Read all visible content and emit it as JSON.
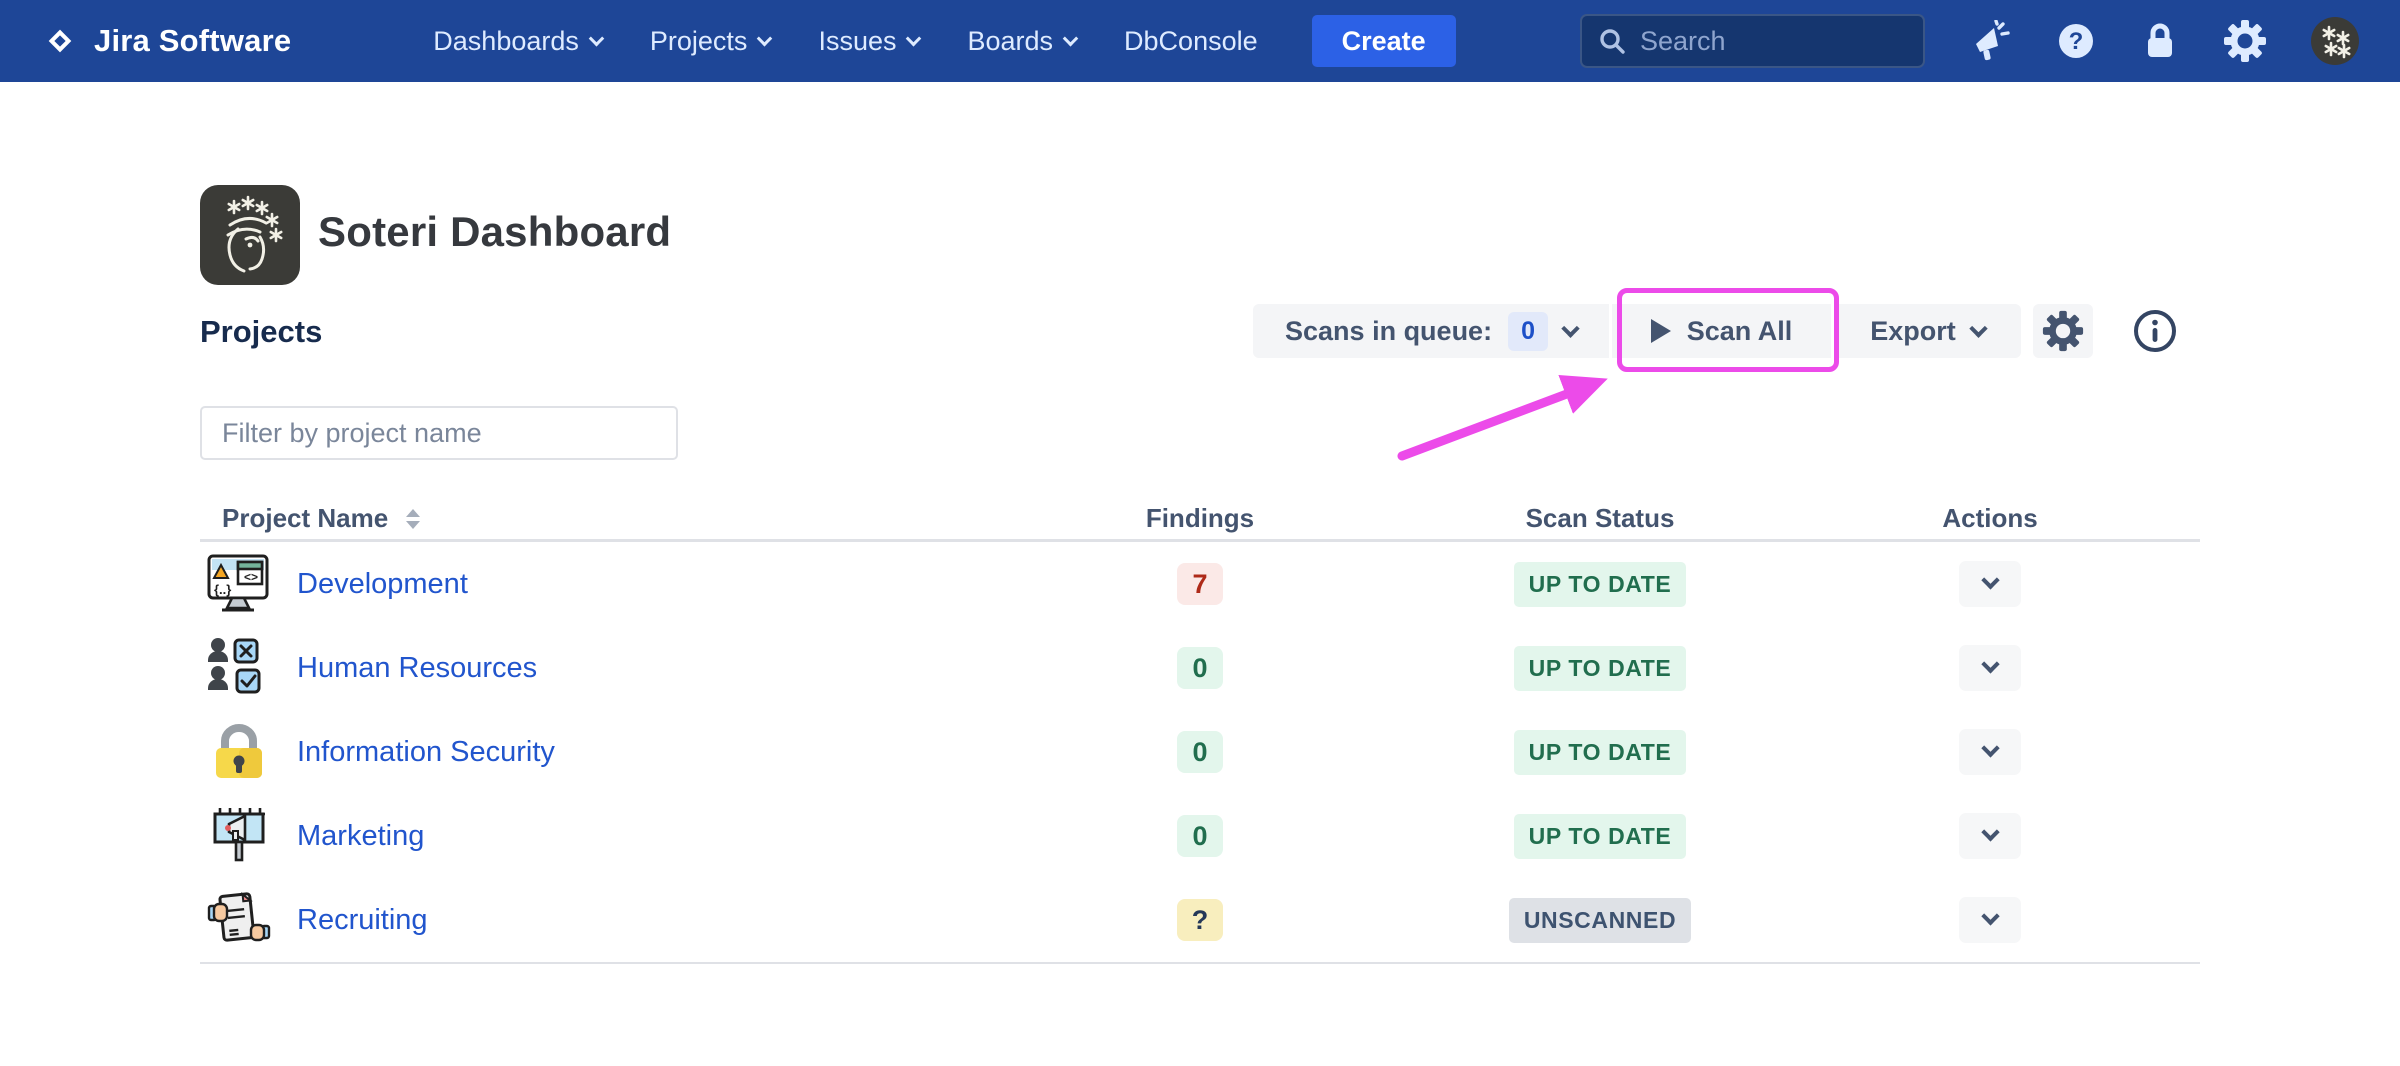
{
  "nav": {
    "brand": "Jira Software",
    "items": [
      {
        "label": "Dashboards",
        "has_chevron": true
      },
      {
        "label": "Projects",
        "has_chevron": true
      },
      {
        "label": "Issues",
        "has_chevron": true
      },
      {
        "label": "Boards",
        "has_chevron": true
      },
      {
        "label": "DbConsole",
        "has_chevron": false
      }
    ],
    "create_label": "Create",
    "search_placeholder": "Search"
  },
  "header": {
    "title": "Soteri Dashboard"
  },
  "section": {
    "heading": "Projects"
  },
  "controls": {
    "scans_in_queue_label": "Scans in queue:",
    "scans_in_queue_count": "0",
    "scan_all_label": "Scan All",
    "export_label": "Export"
  },
  "filter": {
    "placeholder": "Filter by project name"
  },
  "table": {
    "columns": [
      "Project Name",
      "Findings",
      "Scan Status",
      "Actions"
    ],
    "rows": [
      {
        "name": "Development",
        "icon": "development",
        "findings": "7",
        "findings_type": "danger",
        "status": "UP TO DATE",
        "status_type": "success"
      },
      {
        "name": "Human Resources",
        "icon": "human-resources",
        "findings": "0",
        "findings_type": "success",
        "status": "UP TO DATE",
        "status_type": "success"
      },
      {
        "name": "Information Security",
        "icon": "information-security",
        "findings": "0",
        "findings_type": "success",
        "status": "UP TO DATE",
        "status_type": "success"
      },
      {
        "name": "Marketing",
        "icon": "marketing",
        "findings": "0",
        "findings_type": "success",
        "status": "UP TO DATE",
        "status_type": "success"
      },
      {
        "name": "Recruiting",
        "icon": "recruiting",
        "findings": "?",
        "findings_type": "unknown",
        "status": "UNSCANNED",
        "status_type": "neutral"
      }
    ]
  },
  "colors": {
    "nav-bg": "#1E4697",
    "create-bg": "#2C61E6",
    "annotation": "#EC4BE9",
    "link": "#2155CD",
    "success-bg": "#E3F6EC",
    "success-text": "#216E4E",
    "danger-bg": "#FBE9E7",
    "danger-text": "#AE2A19",
    "warning-bg": "#F8EEBE",
    "neutral-bg": "#DEE1E6",
    "neutral-text": "#3E5370"
  }
}
